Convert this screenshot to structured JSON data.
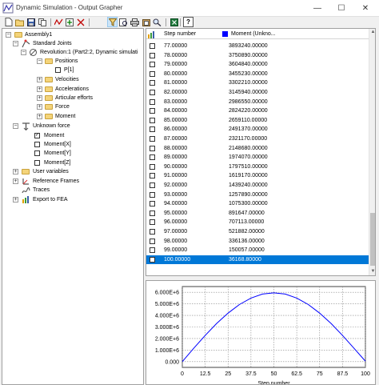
{
  "window": {
    "title": "Dynamic Simulation - Output Grapher",
    "minimize": "—",
    "maximize": "☐",
    "close": "✕"
  },
  "toolbar": {
    "buttons": [
      "new-icon",
      "open-icon",
      "save-icon",
      "copy-icon",
      "curve-icon",
      "add-curve-icon",
      "filter-icon",
      "preview-icon",
      "print-icon",
      "paste-icon",
      "zoom-icon",
      "excel-icon",
      "help-icon"
    ],
    "help_label": "?"
  },
  "tree": {
    "items": [
      {
        "label": "Assembly1",
        "expander": "−"
      },
      {
        "label": "Standard Joints",
        "expander": "−"
      },
      {
        "label": "Revolution:1 (Part2:2, Dynamic simulati",
        "expander": "−"
      },
      {
        "label": "Positions",
        "expander": "−"
      },
      {
        "label": "P[1]"
      },
      {
        "label": "Velocities",
        "expander": "+"
      },
      {
        "label": "Accelerations",
        "expander": "+"
      },
      {
        "label": "Articular efforts",
        "expander": "+"
      },
      {
        "label": "Force",
        "expander": "+"
      },
      {
        "label": "Moment",
        "expander": "+"
      },
      {
        "label": "Unknown force",
        "expander": "−"
      },
      {
        "label": "Moment",
        "check": "✓"
      },
      {
        "label": "Moment[X]"
      },
      {
        "label": "Moment[Y]"
      },
      {
        "label": "Moment[Z]"
      },
      {
        "label": "User variables",
        "expander": "+"
      },
      {
        "label": "Reference Frames",
        "expander": "+"
      },
      {
        "label": "Traces"
      },
      {
        "label": "Export to FEA",
        "expander": "+"
      }
    ]
  },
  "table": {
    "headers": {
      "step": "Step number",
      "moment": "Moment (Unkno..."
    },
    "series_color": "#0000ff",
    "rows": [
      {
        "step": "77.00000",
        "moment": "3893240.00000"
      },
      {
        "step": "78.00000",
        "moment": "3750890.00000"
      },
      {
        "step": "79.00000",
        "moment": "3604840.00000"
      },
      {
        "step": "80.00000",
        "moment": "3455230.00000"
      },
      {
        "step": "81.00000",
        "moment": "3302210.00000"
      },
      {
        "step": "82.00000",
        "moment": "3145940.00000"
      },
      {
        "step": "83.00000",
        "moment": "2986550.00000"
      },
      {
        "step": "84.00000",
        "moment": "2824220.00000"
      },
      {
        "step": "85.00000",
        "moment": "2659110.00000"
      },
      {
        "step": "86.00000",
        "moment": "2491370.00000"
      },
      {
        "step": "87.00000",
        "moment": "2321170.00000"
      },
      {
        "step": "88.00000",
        "moment": "2148680.00000"
      },
      {
        "step": "89.00000",
        "moment": "1974070.00000"
      },
      {
        "step": "90.00000",
        "moment": "1797510.00000"
      },
      {
        "step": "91.00000",
        "moment": "1619170.00000"
      },
      {
        "step": "92.00000",
        "moment": "1439240.00000"
      },
      {
        "step": "93.00000",
        "moment": "1257890.00000"
      },
      {
        "step": "94.00000",
        "moment": "1075300.00000"
      },
      {
        "step": "95.00000",
        "moment": "891647.00000"
      },
      {
        "step": "96.00000",
        "moment": "707113.00000"
      },
      {
        "step": "97.00000",
        "moment": "521882.00000"
      },
      {
        "step": "98.00000",
        "moment": "336136.00000"
      },
      {
        "step": "99.00000",
        "moment": "150057.00000"
      },
      {
        "step": "100.00000",
        "moment": "36168.80000",
        "selected": true
      }
    ]
  },
  "chart_data": {
    "type": "line",
    "series": [
      {
        "color": "#0000ff",
        "x": [
          0,
          6.25,
          12.5,
          18.75,
          25,
          31.25,
          37.5,
          43.75,
          50,
          56.25,
          62.5,
          68.75,
          75,
          81.25,
          87.5,
          93.75,
          100
        ],
        "y": [
          0,
          1160000,
          2270000,
          3300000,
          4200000,
          4950000,
          5500000,
          5850000,
          5950000,
          5850000,
          5500000,
          4950000,
          4200000,
          3300000,
          2270000,
          1160000,
          36168.8
        ]
      }
    ],
    "x_ticks": [
      "0",
      "12.5",
      "25",
      "37.5",
      "50",
      "62.5",
      "75",
      "87.5",
      "100"
    ],
    "y_ticks": [
      "0.000",
      "1.000E+6",
      "2.000E+6",
      "3.000E+6",
      "4.000E+6",
      "5.000E+6",
      "6.000E+6"
    ],
    "xlim": [
      0,
      100
    ],
    "ylim": [
      -500000,
      6500000
    ],
    "grid": true,
    "xlabel": "Step number"
  }
}
